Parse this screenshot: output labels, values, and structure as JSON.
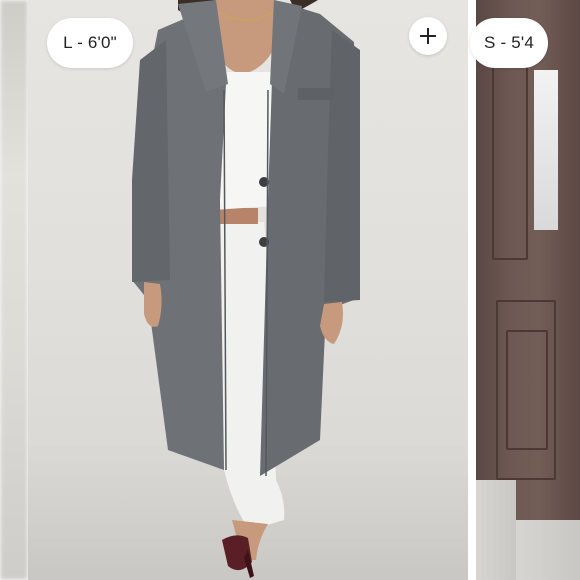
{
  "carousel": {
    "slides": [
      {
        "size_label": "L - 6'0\""
      },
      {
        "size_label": "S - 5'4"
      }
    ]
  },
  "add_button": {
    "icon": "plus-icon"
  },
  "colors": {
    "backdrop": "#e3e1dd",
    "coat": "#6b6e72",
    "top_skirt": "#f4f4f2",
    "door": "#6c5752",
    "pill": "#ffffff"
  }
}
